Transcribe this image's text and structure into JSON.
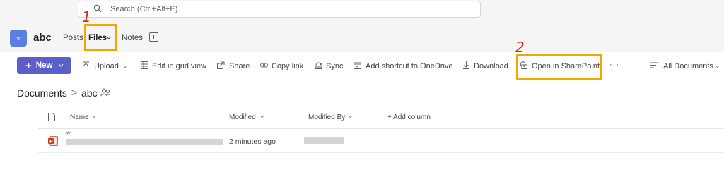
{
  "search": {
    "placeholder": "Search (Ctrl+Alt+E)"
  },
  "team": {
    "avatar_initials": "hn",
    "name": "abc"
  },
  "tabs": [
    {
      "label": "Posts"
    },
    {
      "label": "Files"
    },
    {
      "label": "Notes"
    }
  ],
  "annotations": {
    "step1": "1",
    "step2": "2",
    "color": "#f0a800",
    "number_color": "#d4281c"
  },
  "toolbar": {
    "new_label": "New",
    "upload_label": "Upload",
    "edit_grid_label": "Edit in grid view",
    "share_label": "Share",
    "copy_link_label": "Copy link",
    "sync_label": "Sync",
    "add_shortcut_label": "Add shortcut to OneDrive",
    "download_label": "Download",
    "open_sharepoint_label": "Open in SharePoint",
    "more_label": "···",
    "view_label": "All Documents"
  },
  "breadcrumb": {
    "root": "Documents",
    "separator": ">",
    "current": "abc"
  },
  "table": {
    "columns": {
      "name": "Name",
      "modified": "Modified",
      "modified_by": "Modified By",
      "add_column": "+ Add column"
    },
    "rows": [
      {
        "icon": "powerpoint-file-icon",
        "name": "",
        "modified": "2 minutes ago",
        "modified_by": ""
      }
    ]
  },
  "colors": {
    "accent": "#5b5fc7",
    "avatar": "#5b7fe1",
    "powerpoint": "#c43e1c"
  }
}
